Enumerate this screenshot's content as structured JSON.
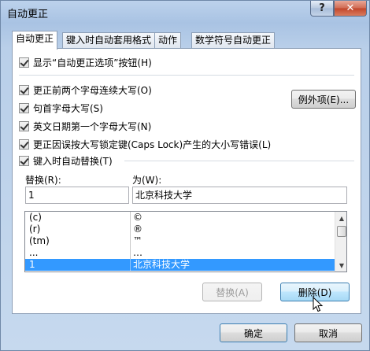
{
  "window": {
    "title": "自动更正",
    "help_glyph": "?",
    "close_glyph": "✕"
  },
  "tabs": [
    "自动更正",
    "键入时自动套用格式",
    "动作",
    "数学符号自动更正"
  ],
  "options": {
    "show_buttons": "显示“自动更正选项”按钮(H)",
    "two_initial_caps": "更正前两个字母连续大写(O)",
    "capitalize_sentences": "句首字母大写(S)",
    "capitalize_days": "英文日期第一个字母大写(N)",
    "caps_lock": "更正因误按大写锁定键(Caps Lock)产生的大小写错误(L)",
    "replace_as_you_type": "键入时自动替换(T)"
  },
  "exceptions_button": "例外项(E)...",
  "replace_label": "替换(R):",
  "with_label": "为(W):",
  "replace_value": "1",
  "with_value": "北京科技大学",
  "list": [
    {
      "from": "(c)",
      "to": "©"
    },
    {
      "from": "(r)",
      "to": "®"
    },
    {
      "from": "(tm)",
      "to": "™"
    },
    {
      "from": "...",
      "to": "…"
    },
    {
      "from": "1",
      "to": "北京科技大学",
      "selected": true
    }
  ],
  "scroll_up": "▲",
  "scroll_down": "▼",
  "replace_button": "替换(A)",
  "delete_button": "删除(D)",
  "ok_button": "确定",
  "cancel_button": "取消"
}
